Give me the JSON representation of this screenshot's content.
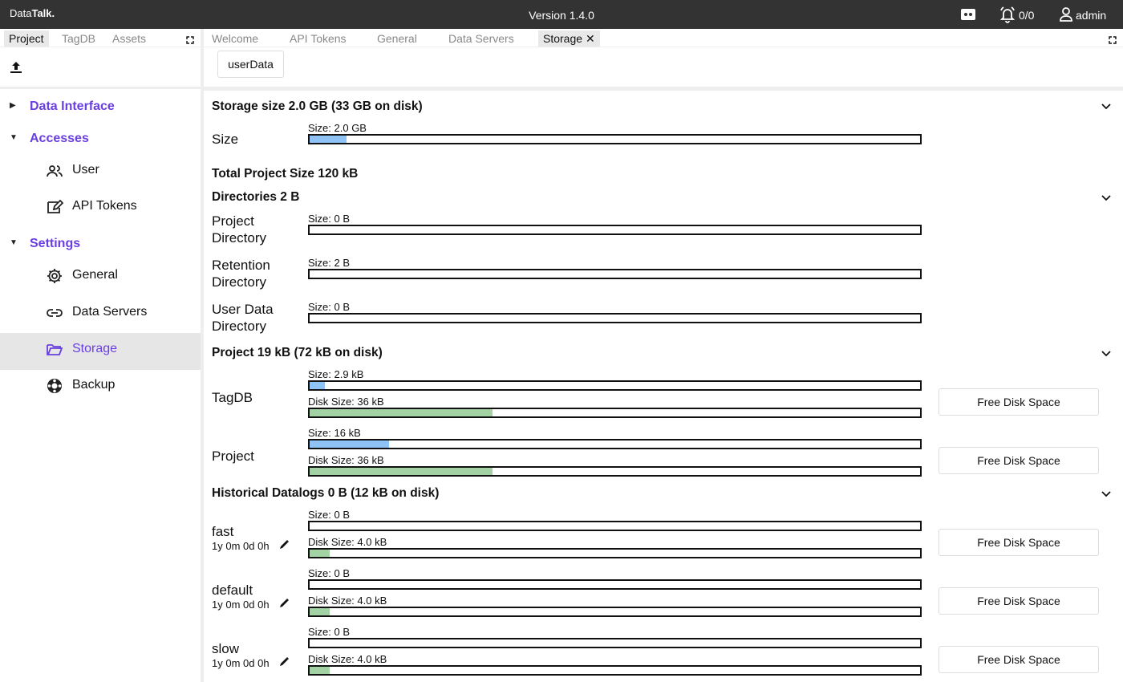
{
  "app": {
    "logo_prefix": "Data",
    "logo_bold": "Talk.",
    "version": "Version 1.4.0",
    "notifications": "0/0",
    "user": "admin"
  },
  "left_tabs": [
    "Project",
    "TagDB",
    "Assets"
  ],
  "nav": {
    "data_interface": "Data Interface",
    "accesses": "Accesses",
    "user": "User",
    "api_tokens": "API Tokens",
    "settings": "Settings",
    "general": "General",
    "data_servers": "Data Servers",
    "storage": "Storage",
    "backup": "Backup"
  },
  "right_tabs": [
    "Welcome",
    "API Tokens",
    "General",
    "Data Servers",
    "Storage"
  ],
  "userdata_button": "userData",
  "storage": {
    "title": "Storage size 2.0 GB (33 GB on disk)",
    "size_label": "Size",
    "size_caption": "Size: 2.0 GB",
    "size_fraction": 0.06
  },
  "total_project": "Total Project Size 120 kB",
  "directories": {
    "title": "Directories 2 B",
    "rows": [
      {
        "label1": "Project",
        "label2": "Directory",
        "caption": "Size: 0 B",
        "fraction": 0
      },
      {
        "label1": "Retention",
        "label2": "Directory",
        "caption": "Size: 2 B",
        "fraction": 0
      },
      {
        "label1": "User Data",
        "label2": "Directory",
        "caption": "Size: 0 B",
        "fraction": 0
      }
    ]
  },
  "project": {
    "title": "Project 19 kB (72 kB on disk)",
    "rows": [
      {
        "label": "TagDB",
        "size_caption": "Size: 2.9 kB",
        "size_fraction": 0.025,
        "disk_caption": "Disk Size: 36 kB",
        "disk_fraction": 0.3,
        "button": "Free Disk Space"
      },
      {
        "label": "Project",
        "size_caption": "Size: 16 kB",
        "size_fraction": 0.13,
        "disk_caption": "Disk Size: 36 kB",
        "disk_fraction": 0.3,
        "button": "Free Disk Space"
      }
    ]
  },
  "historical": {
    "title": "Historical Datalogs 0 B (12 kB on disk)",
    "rows": [
      {
        "label": "fast",
        "retention": "1y 0m 0d 0h",
        "size_caption": "Size: 0 B",
        "size_fraction": 0,
        "disk_caption": "Disk Size: 4.0 kB",
        "disk_fraction": 0.033,
        "button": "Free Disk Space"
      },
      {
        "label": "default",
        "retention": "1y 0m 0d 0h",
        "size_caption": "Size: 0 B",
        "size_fraction": 0,
        "disk_caption": "Disk Size: 4.0 kB",
        "disk_fraction": 0.033,
        "button": "Free Disk Space"
      },
      {
        "label": "slow",
        "retention": "1y 0m 0d 0h",
        "size_caption": "Size: 0 B",
        "size_fraction": 0,
        "disk_caption": "Disk Size: 4.0 kB",
        "disk_fraction": 0.033,
        "button": "Free Disk Space"
      }
    ]
  },
  "colors": {
    "accent": "#6a3fe0",
    "topbar": "#333333",
    "size_bar": "#90c3f5",
    "disk_bar": "#a3d3a5"
  }
}
